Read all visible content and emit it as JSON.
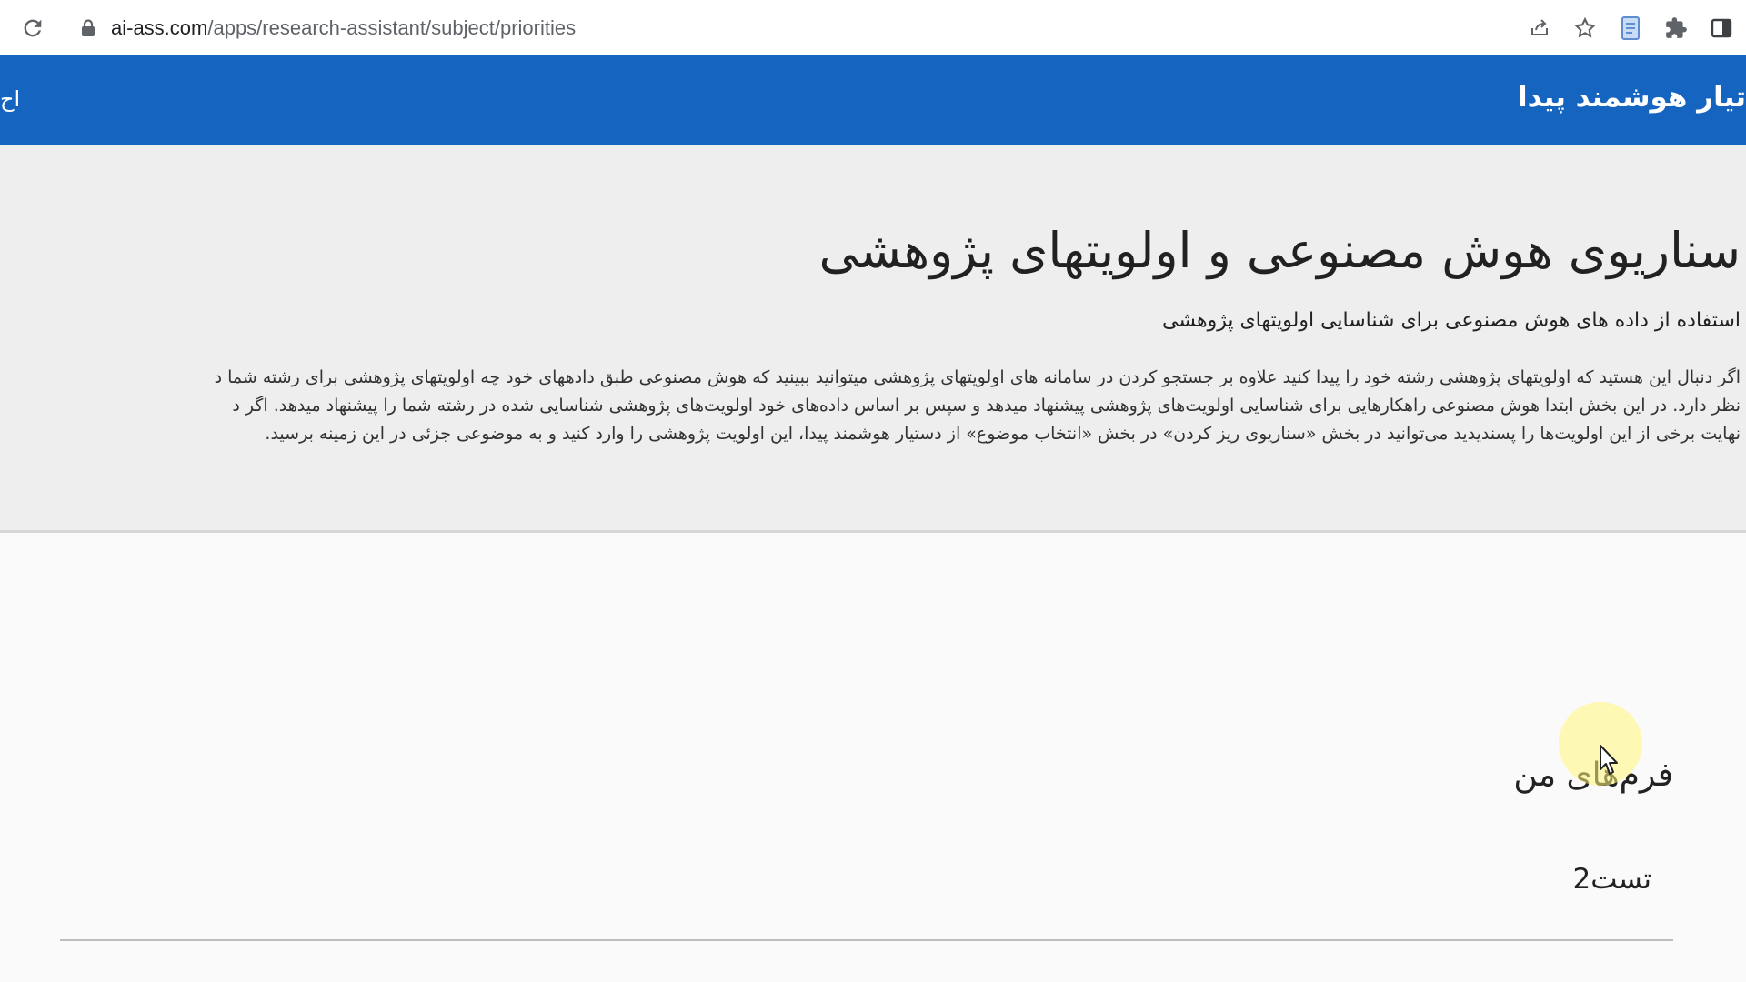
{
  "browser": {
    "url_domain": "ai-ass.com",
    "url_path": "/apps/research-assistant/subject/priorities",
    "icons": [
      "reload-icon",
      "lock-icon",
      "share-icon",
      "star-icon",
      "reading-list-icon",
      "extensions-icon",
      "side-panel-icon"
    ]
  },
  "header": {
    "brand_partial": "تیار هوشمند پیدا",
    "left_partial": "اح",
    "background_color": "#1565c0"
  },
  "hero": {
    "title": "سناریوی هوش مصنوعی و اولویتهای پژوهشی",
    "subtitle": "استفاده از داده های هوش مصنوعی برای شناسایی اولویتهای پژوهشی",
    "description_lines": [
      "اگر دنبال این هستید که اولویتهای پژوهشی رشته خود را پیدا کنید علاوه بر جستجو کردن در سامانه های اولویتهای پژوهشی میتوانید ببینید که هوش مصنوعی طبق دادههای خود چه اولویتهای پژوهشی برای رشته شما د",
      "نظر دارد. در این بخش ابتدا هوش مصنوعی راهکارهایی برای شناسایی اولویت‌های پژوهشی پیشنهاد میدهد و سپس بر اساس داده‌های خود اولویت‌های پژوهشی شناسایی شده در رشته شما را پیشنهاد میدهد. اگر د",
      "نهایت برخی از این اولویت‌ها را پسندیدید می‌توانید در بخش «سناریوی ریز کردن» در بخش «انتخاب موضوع» از دستیار هوشمند پیدا، این اولویت پژوهشی را وارد کنید و به موضوعی جزئی در این زمینه برسید."
    ]
  },
  "main": {
    "forms_heading": "فرم‌های من",
    "forms": [
      {
        "name": "تست2"
      }
    ]
  }
}
